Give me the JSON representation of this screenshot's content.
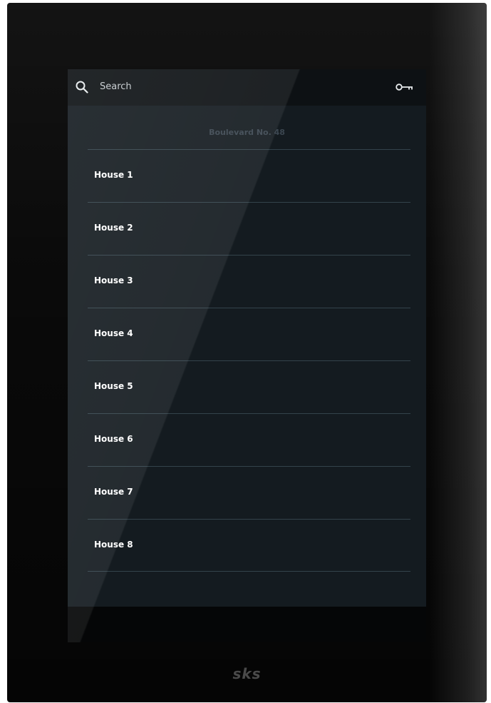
{
  "header": {
    "search_placeholder": "Search",
    "search_icon": "search-icon",
    "key_icon": "key-icon"
  },
  "building": {
    "title": "Boulevard No. 48"
  },
  "houses": [
    {
      "label": "House 1"
    },
    {
      "label": "House 2"
    },
    {
      "label": "House 3"
    },
    {
      "label": "House 4"
    },
    {
      "label": "House 5"
    },
    {
      "label": "House 6"
    },
    {
      "label": "House 7"
    },
    {
      "label": "House 8"
    }
  ],
  "brand": {
    "logo_text": "sks"
  },
  "colors": {
    "device": "#050505",
    "screen": "#141b20",
    "header": "#0d1114",
    "divider": "#33434b",
    "text": "#ffffff",
    "muted_title": "#3b4650"
  }
}
